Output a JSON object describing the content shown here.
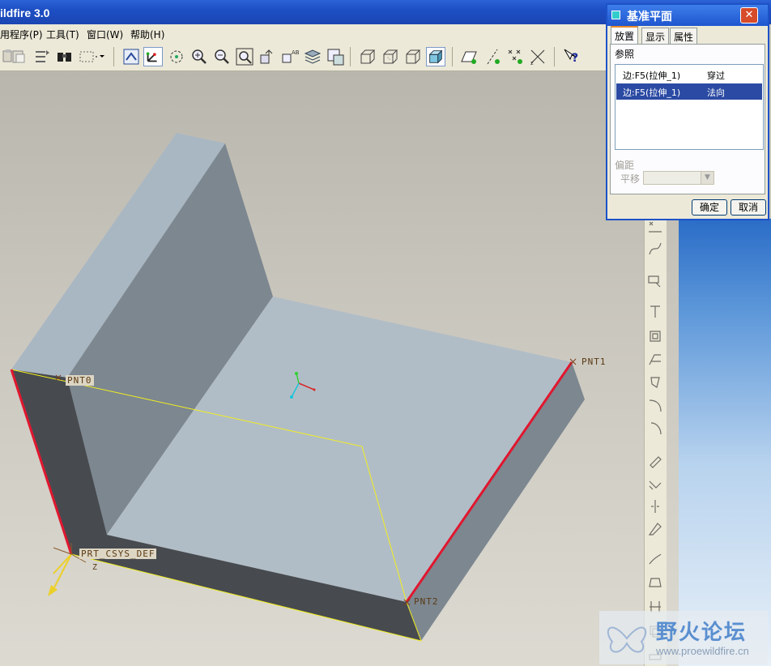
{
  "window": {
    "title": "ildfire 3.0"
  },
  "menu": {
    "items": [
      {
        "label": "用程序(P)"
      },
      {
        "label": "工具(T)"
      },
      {
        "label": "窗口(W)"
      },
      {
        "label": "帮助(H)"
      }
    ]
  },
  "toolbar": {
    "icons": [
      "paste-icon",
      "paste-special-icon",
      "regenerate-icon",
      "find-icon",
      "select-box-icon",
      "redraw-icon",
      "spin-center-icon",
      "orient-mode-icon",
      "zoom-in-icon",
      "zoom-out-icon",
      "refit-icon",
      "reorient-icon",
      "saved-views-icon",
      "layers-icon",
      "view-manager-icon",
      "wireframe-icon",
      "hidden-line-icon",
      "no-hidden-icon",
      "shading-icon",
      "datum-planes-icon",
      "datum-axes-icon",
      "datum-points-icon",
      "coordinate-systems-icon",
      "context-help-icon"
    ],
    "pressed": [
      "orient-mode-icon",
      "shading-icon"
    ]
  },
  "model": {
    "labels": {
      "pnt0": "PNT0",
      "pnt1": "PNT1",
      "pnt2": "PNT2",
      "csys": "PRT_CSYS_DEF",
      "csys_z": "Z"
    },
    "colors": {
      "top_face": "#b1bdc6",
      "wall_face": "#a9b7c3",
      "wall_inner": "#7c8790",
      "front_dark": "#474b50",
      "right_side": "#7d8790",
      "edge_highlight": "#e0172f",
      "plane_outline": "#f2ee1f"
    }
  },
  "dialog": {
    "title": "基准平面",
    "close_label": "✕",
    "tabs": [
      {
        "label": "放置",
        "active": true
      },
      {
        "label": "显示",
        "active": false
      },
      {
        "label": "属性",
        "active": false
      }
    ],
    "references_label": "参照",
    "references": [
      {
        "ref": "边:F5(拉伸_1)",
        "constraint": "穿过",
        "selected": false
      },
      {
        "ref": "边:F5(拉伸_1)",
        "constraint": "法向",
        "selected": true
      }
    ],
    "offset_label": "偏距",
    "translation_label": "平移",
    "translation_value": "",
    "ok_label": "确定",
    "cancel_label": "取消"
  },
  "right_toolbar": {
    "icons": [
      "datum-point-tool-icon",
      "datum-curve-icon",
      "sketch-tool-icon",
      "extrude-icon",
      "revolve-icon",
      "draft-icon",
      "shell-icon",
      "rib-icon",
      "round-icon",
      "chamfer-icon",
      "offset-icon",
      "mirror-icon",
      "merge-icon",
      "trim-icon",
      "extend-icon",
      "pattern-icon",
      "copy-icon",
      "intersect-icon"
    ]
  },
  "watermark": {
    "text_cn": "野火论坛",
    "url": "www.proewildfire.cn"
  }
}
